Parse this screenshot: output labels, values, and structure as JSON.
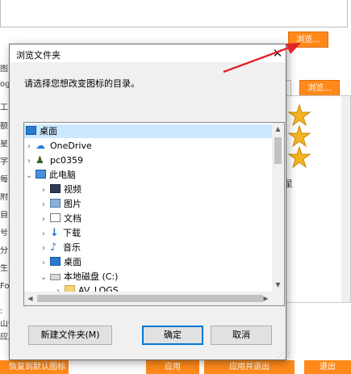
{
  "background": {
    "browse_label_1": "浏览...",
    "browse_label_2": "浏览...",
    "left_fragments": [
      "图",
      "og",
      "工",
      "额",
      "星",
      "字",
      "每",
      "附",
      "自",
      "号",
      "分",
      "生",
      "Fo",
      ":",
      "山保",
      "应用"
    ],
    "right_label": "星",
    "bottom_buttons": {
      "restore": "恢复到默认图标",
      "apply": "应用",
      "apply_exit": "应用并退出",
      "exit": "退出"
    }
  },
  "dialog": {
    "title": "浏览文件夹",
    "close_glyph": "✕",
    "prompt": "请选择您想改变图标的目录。",
    "tree": [
      {
        "label": "桌面",
        "icon": "desktop-icon"
      },
      {
        "label": "OneDrive",
        "icon": "cloud-icon"
      },
      {
        "label": "pc0359",
        "icon": "user-icon"
      },
      {
        "label": "此电脑",
        "icon": "computer-icon"
      },
      {
        "label": "视频",
        "icon": "video-folder-icon"
      },
      {
        "label": "图片",
        "icon": "pictures-folder-icon"
      },
      {
        "label": "文档",
        "icon": "documents-folder-icon"
      },
      {
        "label": "下载",
        "icon": "download-icon"
      },
      {
        "label": "音乐",
        "icon": "music-icon"
      },
      {
        "label": "桌面",
        "icon": "desktop-icon"
      },
      {
        "label": "本地磁盘 (C:)",
        "icon": "drive-icon"
      },
      {
        "label": "AV_LOGS",
        "icon": "folder-icon"
      }
    ],
    "buttons": {
      "new_folder": "新建文件夹(M)",
      "ok": "确定",
      "cancel": "取消"
    }
  },
  "colors": {
    "accent_orange": "#ff8a1a",
    "annotation_red": "#e0262a",
    "selection_blue": "#0078d7"
  }
}
